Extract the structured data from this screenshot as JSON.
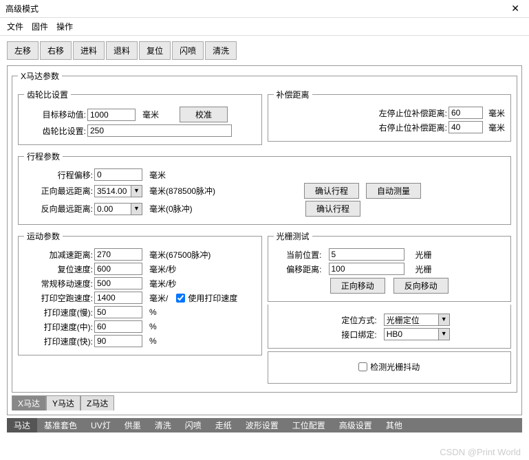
{
  "window": {
    "title": "高级模式",
    "close": "✕"
  },
  "menu": {
    "file": "文件",
    "firmware": "固件",
    "operate": "操作"
  },
  "toolbar": {
    "left": "左移",
    "right": "右移",
    "feed": "进料",
    "retract": "退料",
    "reset": "复位",
    "flash": "闪喷",
    "clean": "清洗"
  },
  "panel_title": "X马达参数",
  "gear": {
    "legend": "齿轮比设置",
    "target_lbl": "目标移动值:",
    "target_val": "1000",
    "target_unit": "毫米",
    "calibrate": "校准",
    "ratio_lbl": "齿轮比设置:",
    "ratio_val": "250"
  },
  "comp": {
    "legend": "补偿距离",
    "left_lbl": "左停止位补偿距离:",
    "left_val": "60",
    "left_unit": "毫米",
    "right_lbl": "右停止位补偿距离:",
    "right_val": "40",
    "right_unit": "毫米"
  },
  "travel": {
    "legend": "行程参数",
    "offset_lbl": "行程偏移:",
    "offset_val": "0",
    "offset_unit": "毫米",
    "fwd_lbl": "正向最远距离:",
    "fwd_val": "3514.00",
    "fwd_unit": "毫米(878500脉冲)",
    "rev_lbl": "反向最远距离:",
    "rev_val": "0.00",
    "rev_unit": "毫米(0脉冲)",
    "confirm": "确认行程",
    "auto": "自动测量",
    "confirm2": "确认行程"
  },
  "motion": {
    "legend": "运动参数",
    "acc_lbl": "加减速距离:",
    "acc_val": "270",
    "acc_unit": "毫米(67500脉冲)",
    "reset_lbl": "复位速度:",
    "reset_val": "600",
    "reset_unit": "毫米/秒",
    "normal_lbl": "常规移动速度:",
    "normal_val": "500",
    "normal_unit": "毫米/秒",
    "idle_lbl": "打印空跑速度:",
    "idle_val": "1400",
    "idle_unit": "毫米/",
    "use_print": "使用打印速度",
    "slow_lbl": "打印速度(慢):",
    "slow_val": "50",
    "slow_unit": "%",
    "mid_lbl": "打印速度(中):",
    "mid_val": "60",
    "mid_unit": "%",
    "fast_lbl": "打印速度(快):",
    "fast_val": "90",
    "fast_unit": "%"
  },
  "grating": {
    "legend": "光栅测试",
    "pos_lbl": "当前位置:",
    "pos_val": "5",
    "pos_unit": "光栅",
    "off_lbl": "偏移距离:",
    "off_val": "100",
    "off_unit": "光栅",
    "fwd_btn": "正向移动",
    "rev_btn": "反向移动"
  },
  "loc": {
    "mode_lbl": "定位方式:",
    "mode_val": "光栅定位",
    "bind_lbl": "接口绑定:",
    "bind_val": "HB0",
    "detect": "检测光栅抖动"
  },
  "subtabs": {
    "x": "X马达",
    "y": "Y马达",
    "z": "Z马达"
  },
  "maintabs": {
    "motor": "马达",
    "base": "基准套色",
    "uv": "UV灯",
    "ink": "供墨",
    "clean": "清洗",
    "flash": "闪喷",
    "paper": "走纸",
    "wave": "波形设置",
    "station": "工位配置",
    "adv": "高级设置",
    "other": "其他"
  },
  "watermark": "CSDN @Print World"
}
